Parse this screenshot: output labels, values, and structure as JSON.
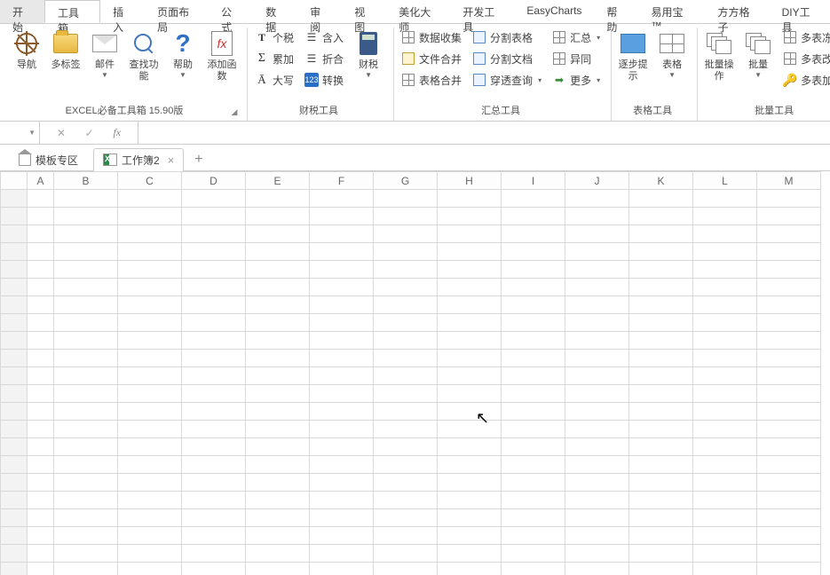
{
  "menu": {
    "tabs": [
      "开始",
      "工具箱",
      "插入",
      "页面布局",
      "公式",
      "数据",
      "审阅",
      "视图",
      "美化大师",
      "开发工具",
      "EasyCharts",
      "帮助",
      "易用宝 ™",
      "方方格子",
      "DIY工具"
    ],
    "active_index": 1
  },
  "ribbon": {
    "group1": {
      "label": "EXCEL必备工具箱 15.90版",
      "nav": "导航",
      "tabs": "多标签",
      "mail": "邮件",
      "find": "查找功能",
      "help": "帮助",
      "addfn": "添加函数"
    },
    "group2": {
      "label": "财税工具",
      "tax": "个税",
      "inc": "含入",
      "sum": "累加",
      "fold": "折合",
      "cap": "大写",
      "conv": "转换",
      "fin": "财税"
    },
    "group3": {
      "label": "汇总工具",
      "collect": "数据收集",
      "splittbl": "分割表格",
      "summary": "汇总",
      "filemerge": "文件合并",
      "splitdoc": "分割文档",
      "diff": "异同",
      "tblmerge": "表格合并",
      "pierce": "穿透查询",
      "more": "更多"
    },
    "group4": {
      "label": "表格工具",
      "step": "逐步提示",
      "table": "表格"
    },
    "group5": {
      "label": "批量工具",
      "batchop": "批量操作",
      "batch": "批量",
      "mfreeze": "多表冻结",
      "mrename": "多表改名",
      "mencrypt": "多表加密"
    }
  },
  "formulabar": {
    "fx": "fx",
    "value": ""
  },
  "sheettabs": {
    "templates": "模板专区",
    "wb": "工作簿2"
  },
  "columns": [
    "A",
    "B",
    "C",
    "D",
    "E",
    "F",
    "G",
    "H",
    "I",
    "J",
    "K",
    "L",
    "M"
  ],
  "rows": 22
}
